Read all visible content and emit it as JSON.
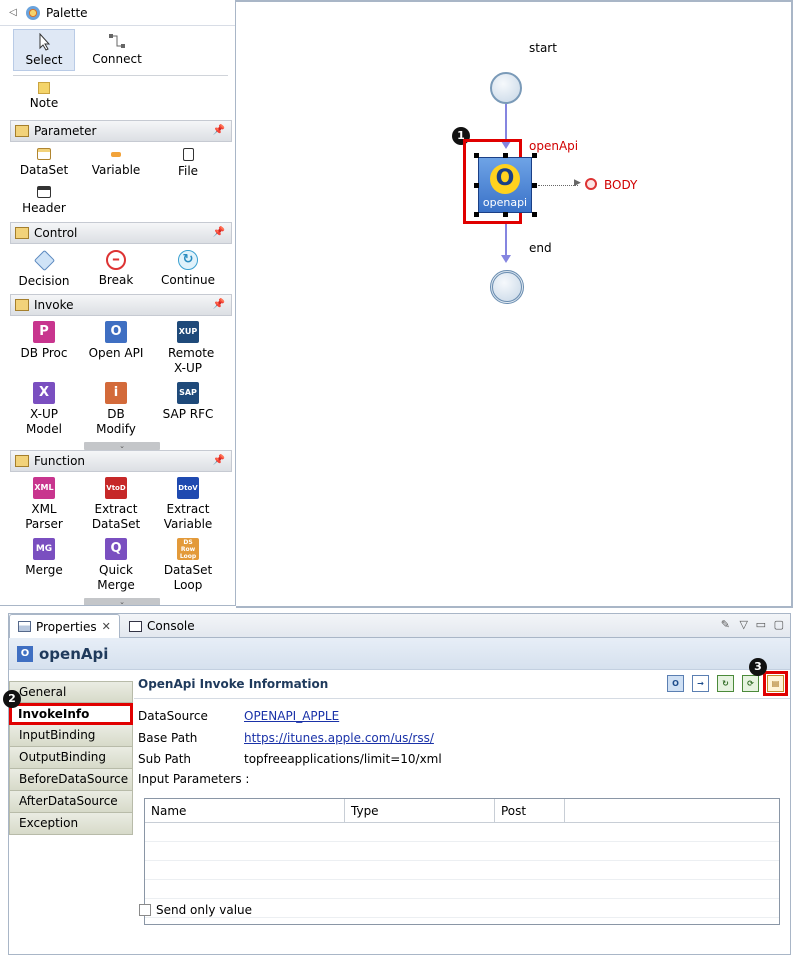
{
  "palette": {
    "title": "Palette",
    "tools": {
      "select": "Select",
      "connect": "Connect",
      "note": "Note"
    },
    "groups": {
      "parameter": {
        "title": "Parameter",
        "items": [
          "DataSet",
          "Variable",
          "File",
          "Header"
        ]
      },
      "control": {
        "title": "Control",
        "items": [
          "Decision",
          "Break",
          "Continue"
        ]
      },
      "invoke": {
        "title": "Invoke",
        "items": [
          "DB Proc",
          "Open API",
          "Remote X-UP",
          "X-UP Model",
          "DB Modify",
          "SAP RFC"
        ]
      },
      "function": {
        "title": "Function",
        "items": [
          "XML Parser",
          "Extract DataSet",
          "Extract Variable",
          "Merge",
          "Quick Merge",
          "DataSet Loop"
        ]
      }
    },
    "icon_text": {
      "dbproc": "P",
      "openapi": "O",
      "remote": "XUP",
      "xupmodel": "X",
      "dbmodify": "i",
      "sap": "SAP",
      "xml": "XML",
      "vtod": "VtoD",
      "dtov": "DtoV",
      "mg": "MG",
      "q": "Q",
      "loop": "DS Row Loop"
    }
  },
  "canvas": {
    "start_label": "start",
    "end_label": "end",
    "node_title": "openApi",
    "node_icon_letter": "O",
    "node_icon_text": "openapi",
    "body_label": "BODY",
    "badge1": "1"
  },
  "tabs": {
    "properties": "Properties",
    "console": "Console"
  },
  "properties": {
    "title": "openApi",
    "sidebar": [
      "General",
      "InvokeInfo",
      "InputBinding",
      "OutputBinding",
      "BeforeDataSource",
      "AfterDataSource",
      "Exception"
    ],
    "section_title": "OpenApi Invoke Information",
    "toolbar_icons": [
      "O",
      "→",
      "↻",
      "⟳",
      "▤"
    ],
    "fields": {
      "datasource_label": "DataSource",
      "datasource_value": "OPENAPI_APPLE",
      "basepath_label": "Base Path",
      "basepath_value": "https://itunes.apple.com/us/rss/",
      "subpath_label": "Sub Path",
      "subpath_value": "topfreeapplications/limit=10/xml",
      "input_params_label": "Input Parameters :"
    },
    "table_headers": [
      "Name",
      "Type",
      "Post"
    ],
    "send_only_value": "Send only value",
    "badge2": "2",
    "badge3": "3"
  },
  "colors": {
    "highlight": "#e00000",
    "link": "#1a32a8",
    "flow_line": "#8585e0"
  }
}
